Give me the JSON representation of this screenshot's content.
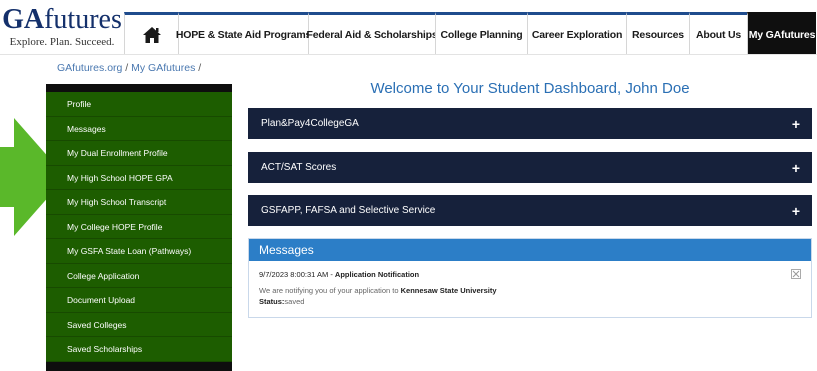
{
  "logo": {
    "ga": "GA",
    "futures": "futures",
    "tagline": "Explore. Plan. Succeed."
  },
  "nav": {
    "home_icon": "home-icon",
    "items": [
      "HOPE & State Aid Programs",
      "Federal Aid & Scholarships",
      "College Planning",
      "Career Exploration",
      "Resources",
      "About Us",
      "My GAfutures"
    ]
  },
  "breadcrumb": {
    "home": "GAfutures.org",
    "current": "My GAfutures",
    "sep": "/"
  },
  "sidebar": {
    "items": [
      "Profile",
      "Messages",
      "My Dual Enrollment Profile",
      "My High School HOPE GPA",
      "My High School Transcript",
      "My College HOPE Profile",
      "My GSFA State Loan (Pathways)",
      "College Application",
      "Document Upload",
      "Saved Colleges",
      "Saved Scholarships"
    ]
  },
  "main": {
    "welcome": "Welcome to Your Student Dashboard, John Doe",
    "panels": [
      "Plan&Pay4CollegeGA",
      "ACT/SAT Scores",
      "GSFAPP, FAFSA and Selective Service"
    ],
    "plus": "+",
    "messages": {
      "title": "Messages",
      "timestamp": "9/7/2023 8:00:31 AM",
      "dash": " - ",
      "subject": "Application Notification",
      "body_prefix": "We are notifying you of your application to ",
      "school": "Kennesaw State University",
      "status_label": "Status:",
      "status_value": "saved"
    }
  },
  "colors": {
    "brand_navy": "#14306b",
    "sidebar_green": "#1d5d00",
    "arrow_green": "#5ab82a",
    "panel_dark": "#16213b",
    "message_blue": "#2c7ec7",
    "welcome_blue": "#2a6fb4"
  }
}
